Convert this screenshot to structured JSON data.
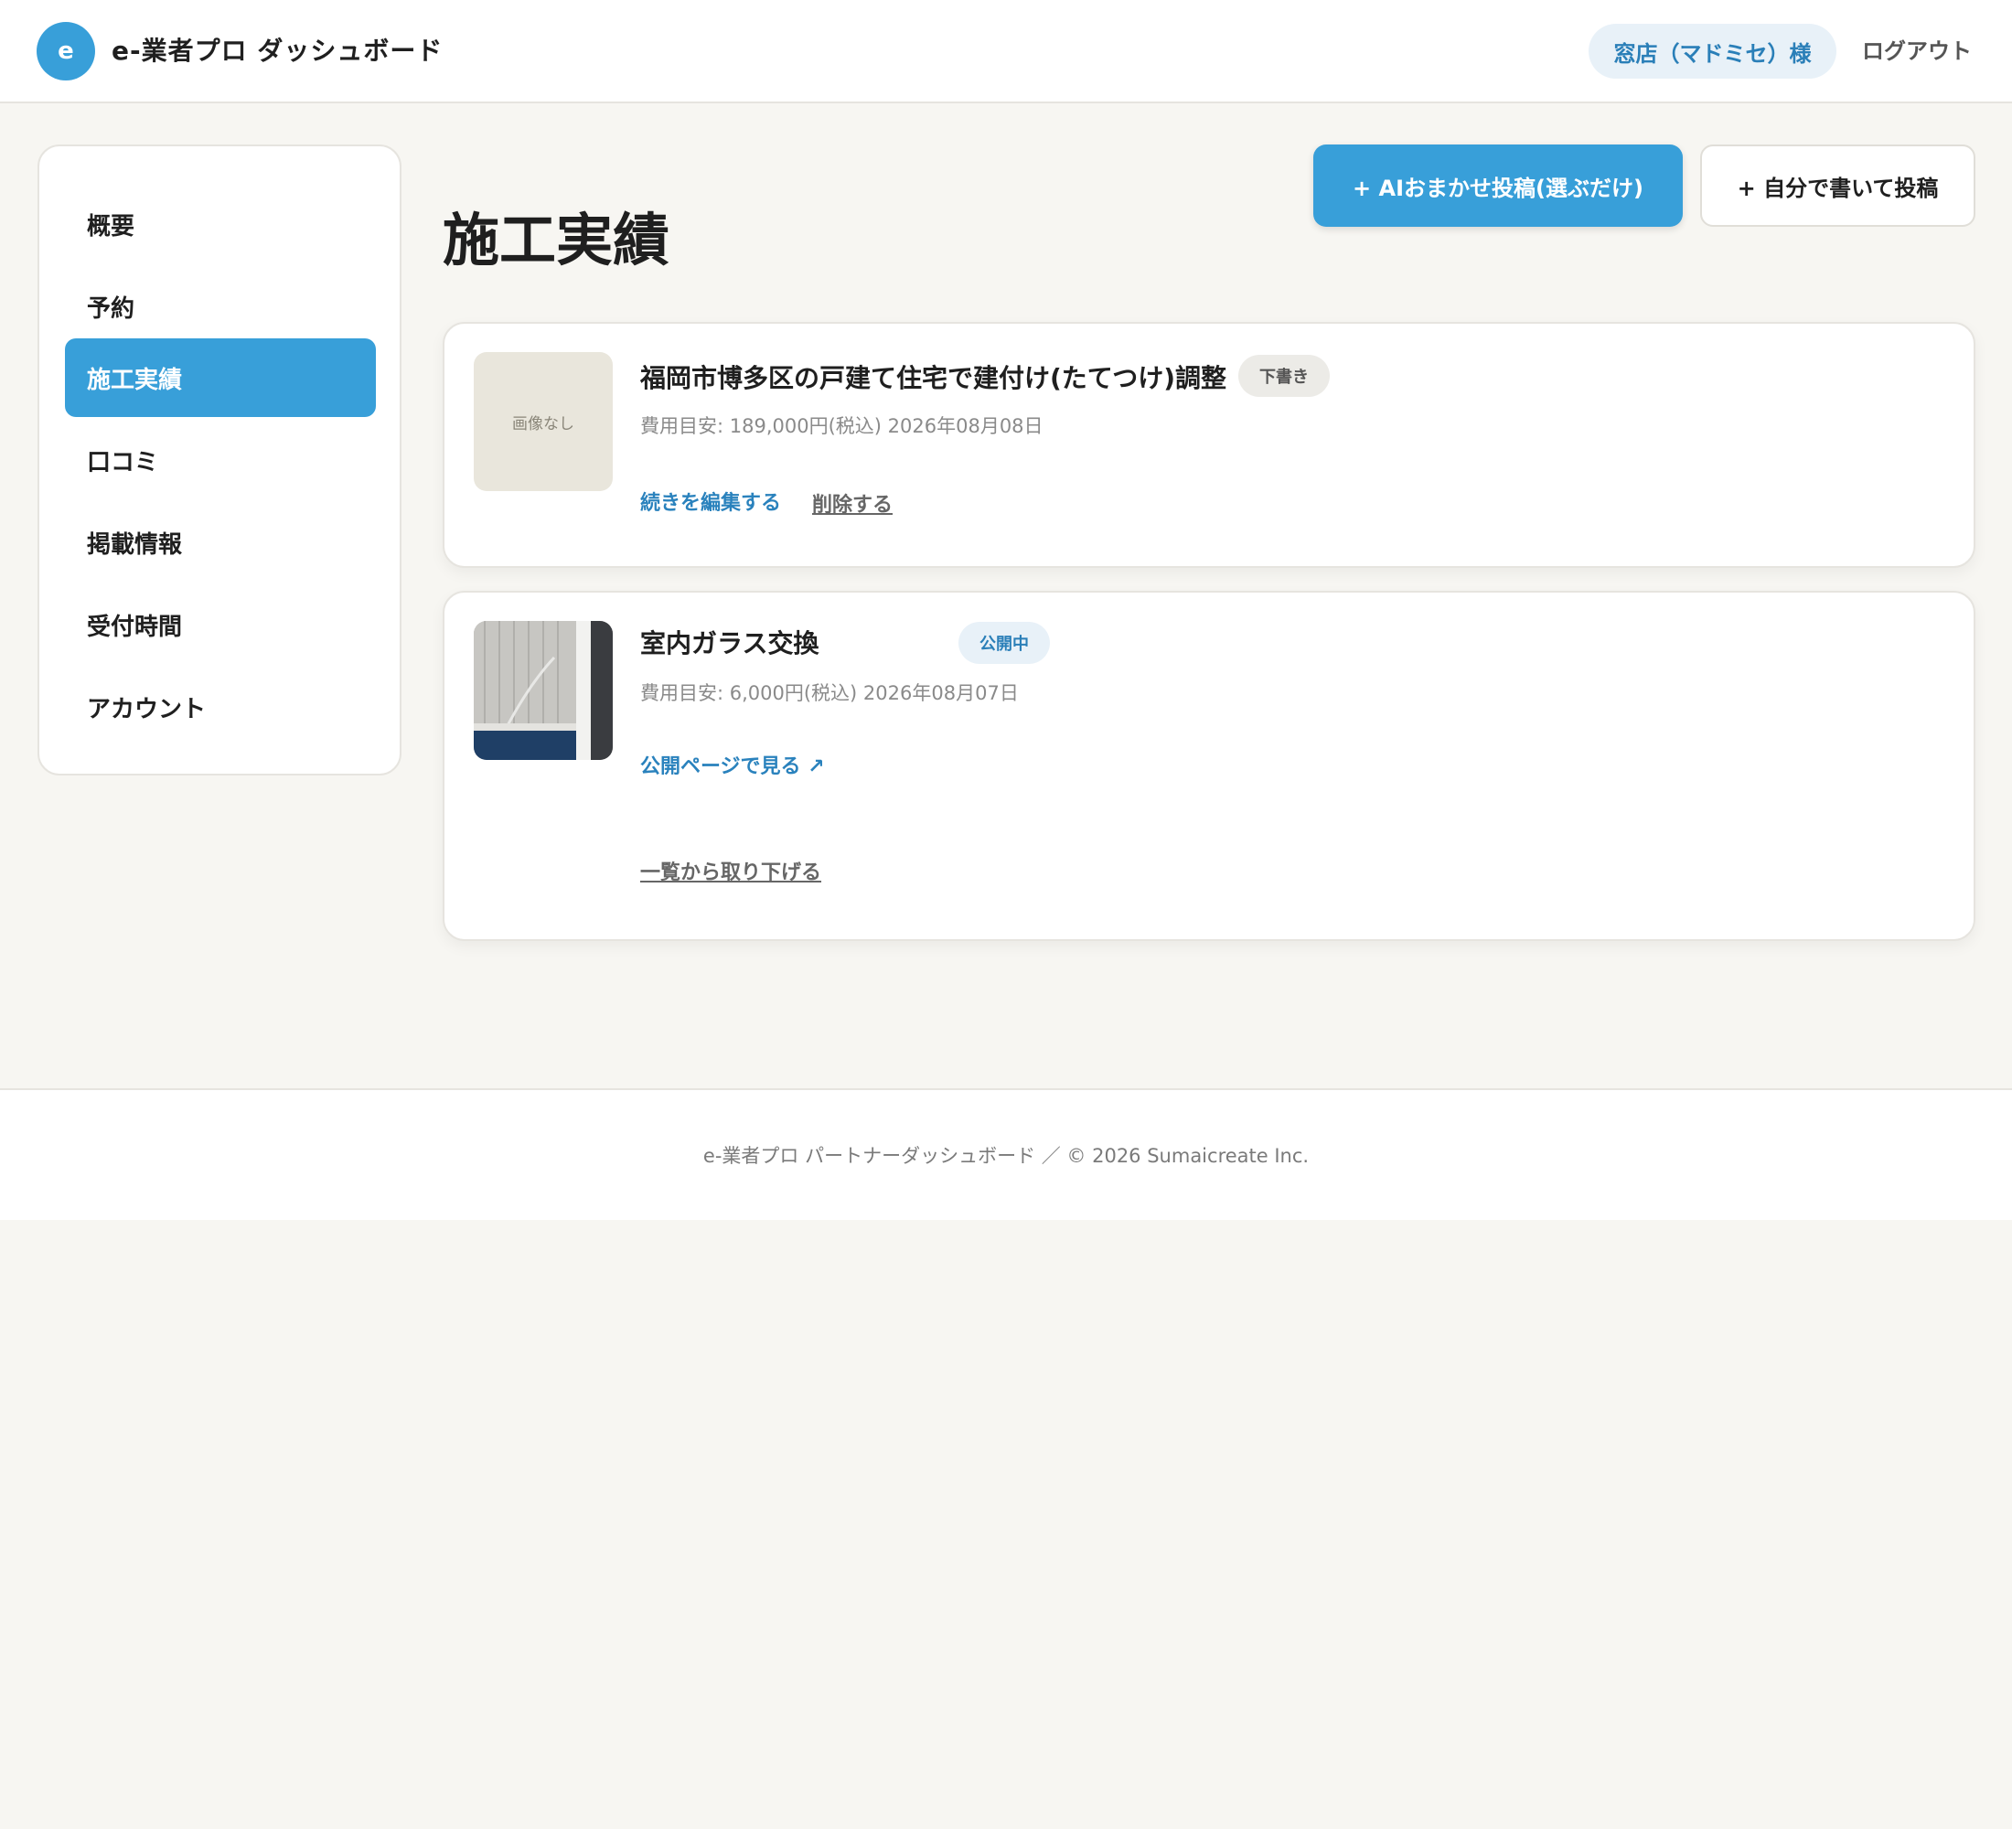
{
  "header": {
    "logo_letter": "e",
    "app_title": "e-業者プロ ダッシュボード",
    "user_label": "窓店（マドミセ）様",
    "logout_label": "ログアウト"
  },
  "sidebar": {
    "items": [
      {
        "label": "概要",
        "active": false
      },
      {
        "label": "予約",
        "active": false
      },
      {
        "label": "施工実績",
        "active": true
      },
      {
        "label": "口コミ",
        "active": false
      },
      {
        "label": "掲載情報",
        "active": false
      },
      {
        "label": "受付時間",
        "active": false
      },
      {
        "label": "アカウント",
        "active": false
      }
    ]
  },
  "main": {
    "page_title": "施工実績",
    "ai_post_button": "+ AIおまかせ投稿(選ぶだけ)",
    "manual_post_button": "+ 自分で書いて投稿",
    "posts": [
      {
        "thumb_text": "画像なし",
        "title": "福岡市博多区の戸建て住宅で建付け(たてつけ)調整",
        "status": "下書き",
        "meta": "費用目安: 189,000円(税込)  2026年08月08日",
        "primary_link": "続きを編集する",
        "secondary_link": "削除する"
      },
      {
        "title": "室内ガラス交換",
        "status": "公開中",
        "meta": "費用目安: 6,000円(税込)  2026年08月07日",
        "primary_link": "公開ページで見る ↗",
        "secondary_link": "一覧から取り下げる"
      }
    ]
  },
  "footer": {
    "text": "e-業者プロ パートナーダッシュボード ／ © 2026 Sumaicreate Inc."
  },
  "colors": {
    "accent": "#389fd9",
    "background": "#f7f6f2"
  }
}
